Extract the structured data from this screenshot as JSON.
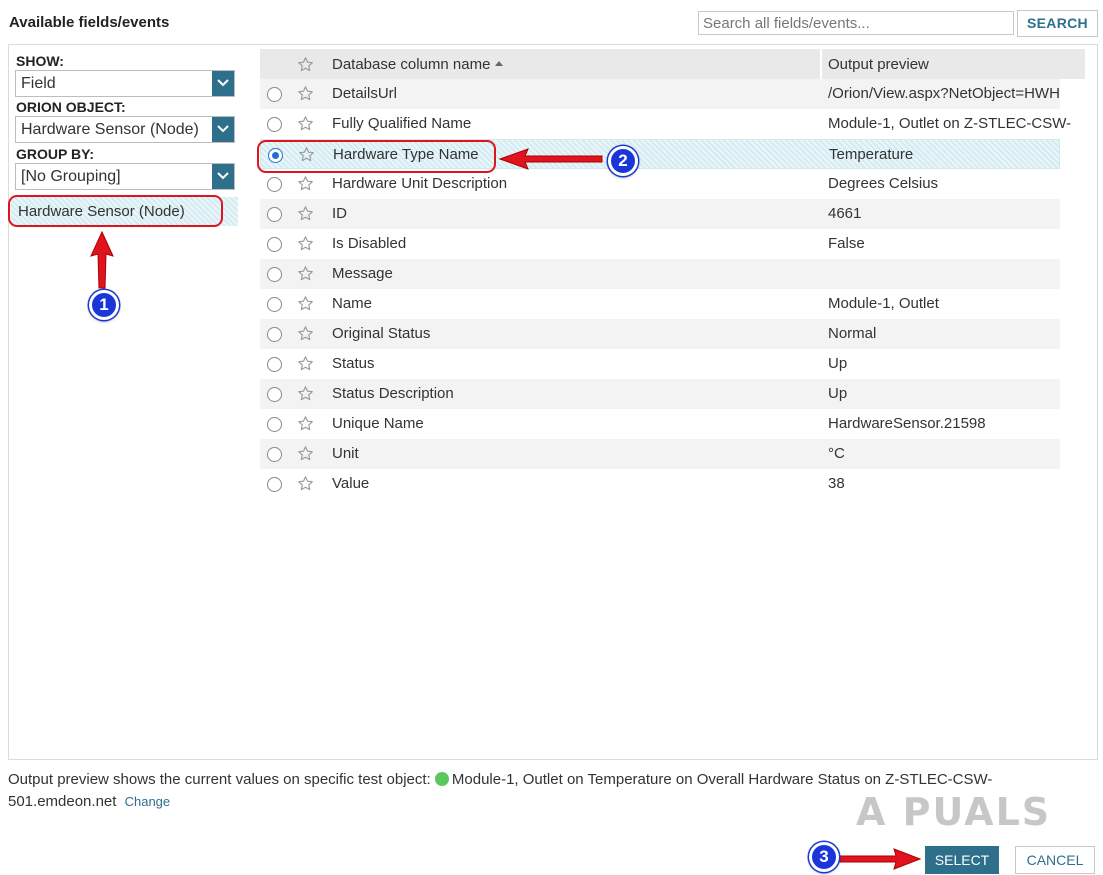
{
  "header": {
    "title": "Available fields/events",
    "search_placeholder": "Search all fields/events...",
    "search_button": "SEARCH"
  },
  "sidebar": {
    "show_label": "SHOW:",
    "show_value": "Field",
    "object_label": "ORION OBJECT:",
    "object_value": "Hardware Sensor (Node)",
    "group_label": "GROUP BY:",
    "group_value": "[No Grouping]",
    "group_item": "Hardware Sensor (Node)"
  },
  "table": {
    "col_name": "Database column name",
    "col_preview": "Output preview",
    "rows": [
      {
        "name": "DetailsUrl",
        "preview": "/Orion/View.aspx?NetObject=HWH",
        "selected": false
      },
      {
        "name": "Fully Qualified Name",
        "preview": "Module-1, Outlet on Z-STLEC-CSW-",
        "selected": false
      },
      {
        "name": "Hardware Type Name",
        "preview": "Temperature",
        "selected": true
      },
      {
        "name": "Hardware Unit Description",
        "preview": "Degrees Celsius",
        "selected": false
      },
      {
        "name": "ID",
        "preview": "4661",
        "selected": false
      },
      {
        "name": "Is Disabled",
        "preview": "False",
        "selected": false
      },
      {
        "name": "Message",
        "preview": "",
        "selected": false
      },
      {
        "name": "Name",
        "preview": "Module-1, Outlet",
        "selected": false
      },
      {
        "name": "Original Status",
        "preview": "Normal",
        "selected": false
      },
      {
        "name": "Status",
        "preview": "Up",
        "selected": false
      },
      {
        "name": "Status Description",
        "preview": "Up",
        "selected": false
      },
      {
        "name": "Unique Name",
        "preview": "HardwareSensor.21598",
        "selected": false
      },
      {
        "name": "Unit",
        "preview": "°C",
        "selected": false
      },
      {
        "name": "Value",
        "preview": "38",
        "selected": false
      }
    ]
  },
  "footer": {
    "prefix": "Output preview shows the current values on specific test object:",
    "object_line1": "Module-1, Outlet on Temperature on Overall Hardware Status on Z-STLEC-CSW-",
    "object_line2": "501.emdeon.net",
    "change_link": "Change",
    "status_color": "#5cc75c"
  },
  "buttons": {
    "select": "SELECT",
    "cancel": "CANCEL"
  },
  "annotations": {
    "badge_1": "1",
    "badge_2": "2",
    "badge_3": "3",
    "watermark": "A PUALS"
  },
  "colors": {
    "accent": "#2e6f8c",
    "annotation_red": "#e0141e",
    "badge_blue": "#1b36d8"
  }
}
